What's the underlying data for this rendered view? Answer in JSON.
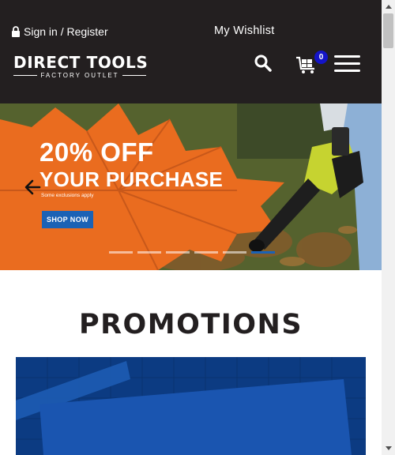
{
  "header": {
    "signin_label": "Sign in / Register",
    "wishlist_label": "My Wishlist",
    "logo_main": "DIRECT TOOLS",
    "logo_sub": "FACTORY OUTLET",
    "cart_count": "0",
    "icons": [
      "lock-icon",
      "search-icon",
      "cart-icon",
      "hamburger-menu-icon"
    ]
  },
  "hero": {
    "headline": "20% OFF",
    "subheadline": "YOUR PURCHASE",
    "note": "Some exclusions apply",
    "cta_label": "SHOP NOW",
    "slide_count": 6,
    "active_slide": 6
  },
  "section": {
    "title": "PROMOTIONS"
  },
  "colors": {
    "header_bg": "#231f20",
    "accent_blue": "#1b62b5",
    "badge_blue": "#1414c8",
    "leaf_orange": "#ea6c1f",
    "promo_card_blue": "#0d3f8a"
  }
}
